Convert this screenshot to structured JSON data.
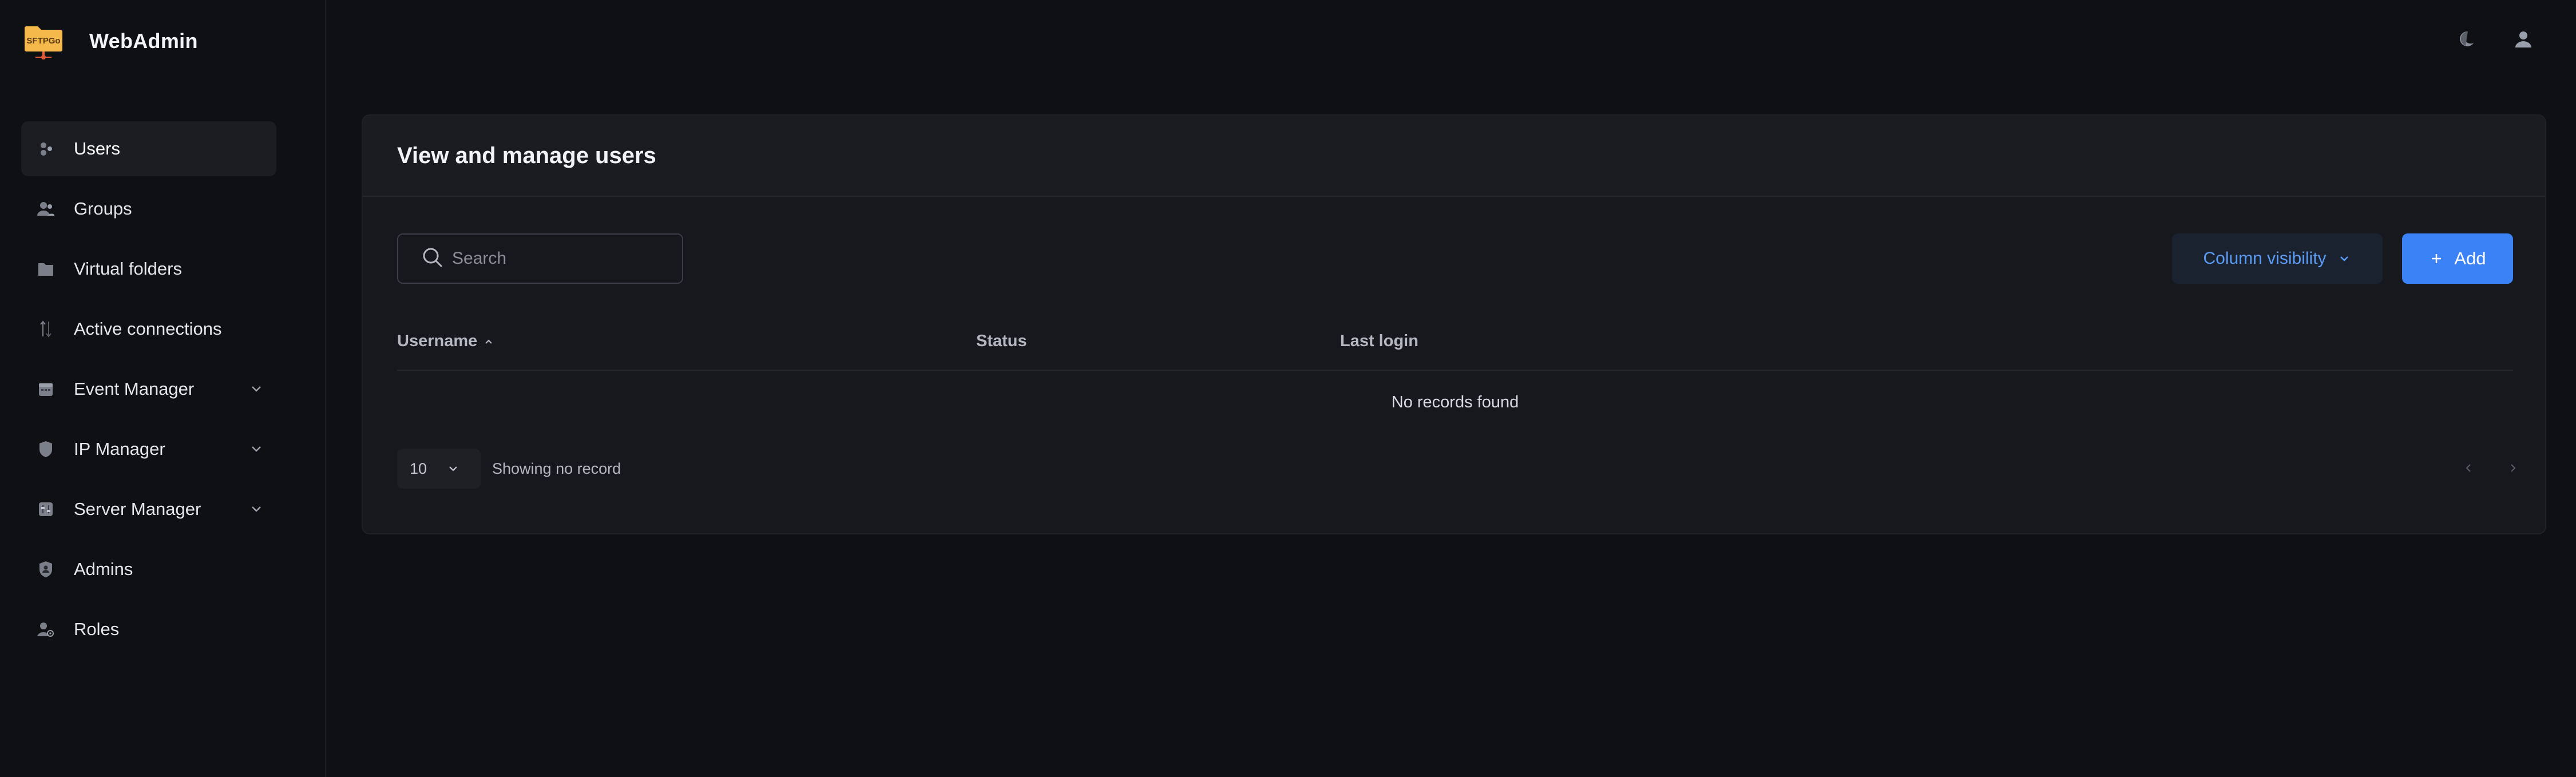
{
  "app": {
    "brand_title": "WebAdmin",
    "logo_text": "SFTPGo"
  },
  "sidebar": {
    "items": [
      {
        "label": "Users",
        "icon": "users-icon",
        "active": true
      },
      {
        "label": "Groups",
        "icon": "groups-icon"
      },
      {
        "label": "Virtual folders",
        "icon": "folder-icon"
      },
      {
        "label": "Active connections",
        "icon": "connections-icon"
      },
      {
        "label": "Event Manager",
        "icon": "calendar-icon",
        "expandable": true
      },
      {
        "label": "IP Manager",
        "icon": "shield-icon",
        "expandable": true
      },
      {
        "label": "Server Manager",
        "icon": "server-icon",
        "expandable": true
      },
      {
        "label": "Admins",
        "icon": "admin-shield-icon"
      },
      {
        "label": "Roles",
        "icon": "roles-icon"
      }
    ]
  },
  "topbar": {
    "theme_icon": "moon-icon",
    "user_icon": "user-icon"
  },
  "card": {
    "title": "View and manage users"
  },
  "search": {
    "placeholder": "Search",
    "value": ""
  },
  "toolbar": {
    "column_visibility_label": "Column visibility",
    "add_label": "Add"
  },
  "table": {
    "columns": [
      "Username",
      "Status",
      "Last login"
    ],
    "sorted_by": "Username",
    "empty_text": "No records found"
  },
  "footer": {
    "page_size": "10",
    "info": "Showing no record"
  },
  "colors": {
    "accent": "#3b82f6",
    "logo": "#f5b84a",
    "background": "#0f1014",
    "card": "#17181d"
  }
}
